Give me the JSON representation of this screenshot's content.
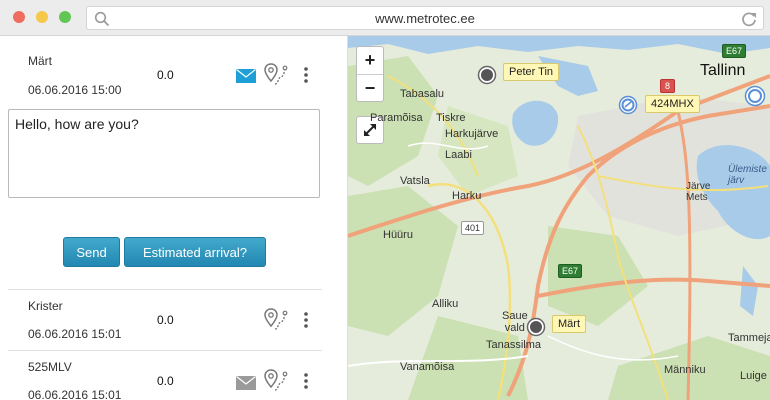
{
  "browser": {
    "url": "www.metrotec.ee"
  },
  "vehicles": [
    {
      "name": "Märt",
      "time": "06.06.2016 15:00",
      "speed": "0.0",
      "has_message": true
    },
    {
      "name": "Krister",
      "time": "06.06.2016 15:01",
      "speed": "0.0",
      "has_message": false
    },
    {
      "name": "525MLV",
      "time": "06.06.2016 15:01",
      "speed": "0.0",
      "has_message": true
    }
  ],
  "message": {
    "text": "Hello, how are you?"
  },
  "buttons": {
    "send": "Send",
    "estimated": "Estimated arrival?"
  },
  "map": {
    "zoom_in": "+",
    "zoom_out": "−",
    "places": {
      "tallinn": "Tallinn",
      "tabasalu": "Tabasalu",
      "paramoisa": "Paramõisa",
      "tiskre": "Tiskre",
      "harkujarve": "Harkujärve",
      "laabi": "Laabi",
      "vatsla": "Vatsla",
      "harku": "Harku",
      "huuru": "Hüüru",
      "allikuu": "Alliku",
      "saue_vald": "Saue\nvald",
      "tanassilma": "Tanassilma",
      "vanamoisa": "Vanamõisa",
      "manniku": "Männiku",
      "tammeja": "Tammeja",
      "luige": "Luige",
      "ulemiste": "Ülemiste\njärv",
      "jarve": "Järve\nMets"
    },
    "roads": {
      "e67_top": "E67",
      "r8": "8",
      "r401": "401",
      "e67_mid": "E67"
    },
    "markers": [
      {
        "label": "Peter Tin"
      },
      {
        "label": "424MHX"
      },
      {
        "label": "Märt"
      }
    ],
    "colors": {
      "water": "#a7cbe8",
      "forest": "#c9dfb0",
      "land": "#e9eee0",
      "road_main": "#f0a27a",
      "road_secondary": "#f3df7c"
    }
  }
}
